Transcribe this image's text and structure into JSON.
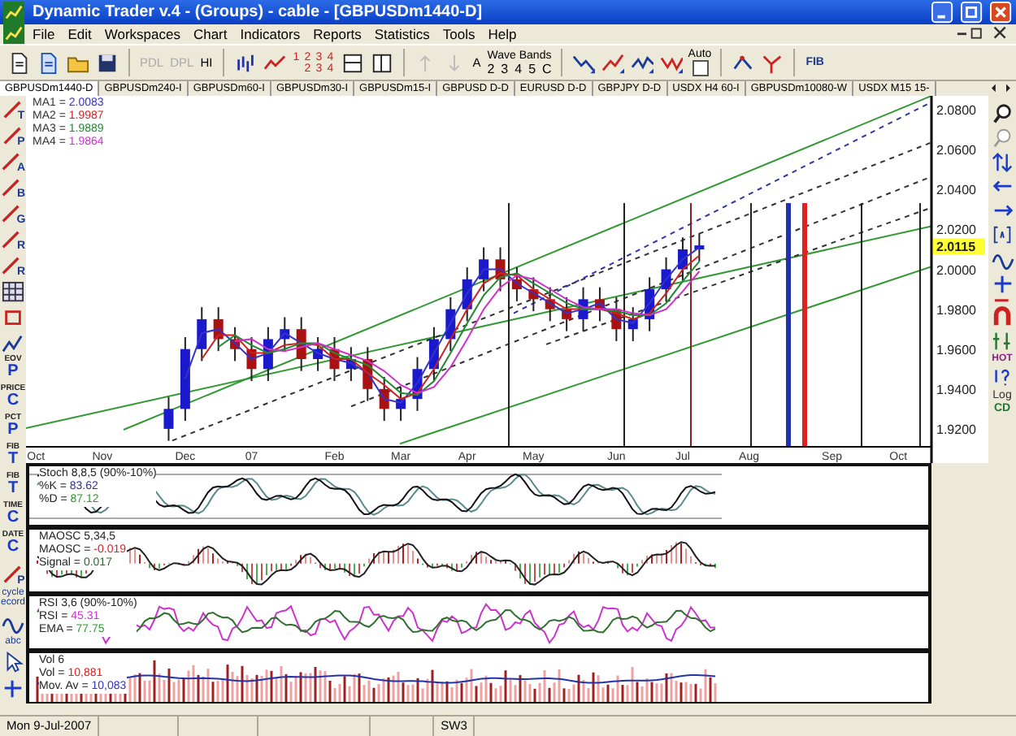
{
  "window": {
    "title": "Dynamic Trader v.4 - (Groups) - cable - [GBPUSDm1440-D]"
  },
  "menu": [
    "File",
    "Edit",
    "Workspaces",
    "Chart",
    "Indicators",
    "Reports",
    "Statistics",
    "Tools",
    "Help"
  ],
  "toolbar": {
    "text_buttons": [
      {
        "label": "PDL",
        "disabled": true
      },
      {
        "label": "DPL",
        "disabled": true
      },
      {
        "label": "HI",
        "disabled": false
      }
    ],
    "bar_counts": [
      [
        "1",
        "2",
        "3",
        "4"
      ],
      [
        "2",
        "3",
        "4"
      ]
    ],
    "letter_button": "A",
    "wave_bands": {
      "title": "Wave Bands",
      "buttons": [
        "2",
        "3",
        "4",
        "5",
        "C"
      ]
    },
    "auto": {
      "label": "Auto",
      "checked": false
    },
    "fib_button": "FIB"
  },
  "tabs": [
    {
      "label": "GBPUSDm1440-D",
      "selected": true
    },
    {
      "label": "GBPUSDm240-I",
      "selected": false
    },
    {
      "label": "GBPUSDm60-I",
      "selected": false
    },
    {
      "label": "GBPUSDm30-I",
      "selected": false
    },
    {
      "label": "GBPUSDm15-I",
      "selected": false
    },
    {
      "label": "GBPUSD D-D",
      "selected": false
    },
    {
      "label": "EURUSD D-D",
      "selected": false
    },
    {
      "label": "GBPJPY D-D",
      "selected": false
    },
    {
      "label": "USDX  H4 60-I",
      "selected": false
    },
    {
      "label": "GBPUSDm10080-W",
      "selected": false
    },
    {
      "label": "USDX  M15 15-",
      "selected": false
    }
  ],
  "left_tools": [
    {
      "kind": "tool",
      "label": "T"
    },
    {
      "kind": "tool",
      "label": "P"
    },
    {
      "kind": "tool",
      "label": "A"
    },
    {
      "kind": "tool",
      "label": "B"
    },
    {
      "kind": "tool",
      "label": "G"
    },
    {
      "kind": "tool",
      "label": "R"
    },
    {
      "kind": "tool",
      "label": "R"
    },
    {
      "kind": "grid"
    },
    {
      "kind": "rect"
    },
    {
      "kind": "zigzag"
    },
    {
      "kind": "stack",
      "top": "EOV",
      "label": "P"
    },
    {
      "kind": "stack",
      "top": "PRICE",
      "label": "C"
    },
    {
      "kind": "stack",
      "top": "PCT",
      "label": "P"
    },
    {
      "kind": "stack",
      "top": "FIB",
      "label": "T"
    },
    {
      "kind": "stack",
      "top": "FIB",
      "label": "T"
    },
    {
      "kind": "stack",
      "top": "TIME",
      "label": "C"
    },
    {
      "kind": "stack",
      "top": "DATE",
      "label": "C"
    },
    {
      "kind": "tool",
      "label": "P"
    },
    {
      "kind": "words",
      "label": "cycle ecord"
    },
    {
      "kind": "wave"
    },
    {
      "kind": "words",
      "label": "abc"
    },
    {
      "kind": "cursor"
    },
    {
      "kind": "plus"
    }
  ],
  "right_tools": [
    {
      "kind": "zoomin"
    },
    {
      "kind": "zoomout"
    },
    {
      "kind": "updown"
    },
    {
      "kind": "left"
    },
    {
      "kind": "right"
    },
    {
      "kind": "bracket"
    },
    {
      "kind": "wave"
    },
    {
      "kind": "plus"
    },
    {
      "kind": "minus"
    },
    {
      "kind": "magnet"
    },
    {
      "kind": "bars"
    },
    {
      "kind": "words",
      "label": "HOT"
    },
    {
      "kind": "help"
    },
    {
      "kind": "words",
      "label": "Log"
    },
    {
      "kind": "words",
      "label": "CD"
    }
  ],
  "price_panel": {
    "moving_averages": [
      {
        "label": "MA1 =",
        "value": "2.0083"
      },
      {
        "label": "MA2 =",
        "value": "1.9987"
      },
      {
        "label": "MA3 =",
        "value": "1.9889"
      },
      {
        "label": "MA4 =",
        "value": "1.9864"
      }
    ],
    "current_price": "2.0115",
    "chart_data": {
      "type": "candlestick",
      "categories": [
        "Oct",
        null,
        null,
        null,
        "Nov",
        null,
        null,
        null,
        null,
        "Dec",
        null,
        null,
        null,
        "07",
        null,
        null,
        null,
        null,
        "Feb",
        null,
        null,
        null,
        "Mar",
        null,
        null,
        null,
        "Apr",
        null,
        null,
        null,
        "May",
        null,
        null,
        null,
        null,
        "Jun",
        null,
        null,
        null,
        "Jul",
        null,
        null,
        null,
        "Aug",
        null,
        null,
        null,
        null,
        "Sep",
        null,
        null,
        null,
        "Oct",
        null
      ],
      "ohlc": [
        null,
        null,
        null,
        null,
        null,
        null,
        null,
        null,
        [
          1.92,
          1.936,
          1.914,
          1.93
        ],
        [
          1.93,
          1.966,
          1.924,
          1.96
        ],
        [
          1.96,
          1.981,
          1.954,
          1.975
        ],
        [
          1.975,
          1.981,
          1.959,
          1.965
        ],
        [
          1.965,
          1.971,
          1.954,
          1.96
        ],
        [
          1.96,
          1.966,
          1.944,
          1.95
        ],
        [
          1.95,
          1.971,
          1.944,
          1.965
        ],
        [
          1.965,
          1.976,
          1.959,
          1.97
        ],
        [
          1.97,
          1.976,
          1.949,
          1.955
        ],
        [
          1.955,
          1.966,
          1.949,
          1.96
        ],
        [
          1.96,
          1.966,
          1.944,
          1.95
        ],
        [
          1.95,
          1.961,
          1.944,
          1.955
        ],
        [
          1.955,
          1.961,
          1.934,
          1.94
        ],
        [
          1.94,
          1.946,
          1.924,
          1.93
        ],
        [
          1.93,
          1.941,
          1.924,
          1.935
        ],
        [
          1.935,
          1.956,
          1.929,
          1.95
        ],
        [
          1.95,
          1.971,
          1.944,
          1.965
        ],
        [
          1.965,
          1.986,
          1.959,
          1.98
        ],
        [
          1.98,
          2.001,
          1.974,
          1.995
        ],
        [
          1.995,
          2.011,
          1.989,
          2.005
        ],
        [
          2.005,
          2.011,
          1.989,
          1.995
        ],
        [
          1.995,
          2.001,
          1.984,
          1.99
        ],
        [
          1.99,
          1.996,
          1.979,
          1.985
        ],
        [
          1.985,
          1.991,
          1.974,
          1.98
        ],
        [
          1.98,
          1.986,
          1.969,
          1.975
        ],
        [
          1.975,
          1.991,
          1.969,
          1.985
        ],
        [
          1.985,
          1.991,
          1.974,
          1.98
        ],
        [
          1.98,
          1.986,
          1.964,
          1.97
        ],
        [
          1.97,
          1.981,
          1.964,
          1.975
        ],
        [
          1.975,
          1.996,
          1.969,
          1.99
        ],
        [
          1.99,
          2.006,
          1.984,
          2.0
        ],
        [
          2.0,
          2.016,
          1.994,
          2.01
        ],
        [
          2.01,
          2.018,
          2.004,
          2.012
        ],
        null,
        null,
        null,
        null,
        null,
        null,
        null,
        null,
        null,
        null,
        null,
        null,
        null
      ],
      "series": [
        {
          "type": "line",
          "color": "#3333cc",
          "values": [
            null,
            null,
            null,
            null,
            null,
            null,
            null,
            null,
            null,
            1.945,
            1.968,
            1.97,
            1.963,
            1.955,
            1.958,
            1.968,
            1.963,
            1.958,
            1.955,
            1.953,
            1.948,
            1.935,
            1.933,
            1.943,
            1.958,
            1.973,
            1.988,
            2.0,
            2.0,
            1.993,
            1.988,
            1.983,
            1.978,
            1.98,
            1.983,
            1.975,
            1.973,
            1.983,
            1.995,
            2.005,
            2.011,
            null,
            null,
            null,
            null,
            null,
            null,
            null,
            null,
            null,
            null,
            null,
            null,
            null
          ]
        },
        {
          "type": "line",
          "color": "#cc2222",
          "values": [
            null,
            null,
            null,
            null,
            null,
            null,
            null,
            null,
            null,
            null,
            1.955,
            1.967,
            1.967,
            1.958,
            1.958,
            1.962,
            1.963,
            1.962,
            1.955,
            1.955,
            1.948,
            1.942,
            1.935,
            1.938,
            1.95,
            1.965,
            1.98,
            1.993,
            1.998,
            1.997,
            1.99,
            1.985,
            1.98,
            1.98,
            1.98,
            1.978,
            1.975,
            1.978,
            1.988,
            2.0,
            2.007,
            null,
            null,
            null,
            null,
            null,
            null,
            null,
            null,
            null,
            null,
            null,
            null,
            null
          ]
        },
        {
          "type": "line",
          "color": "#228833",
          "values": [
            null,
            null,
            null,
            null,
            null,
            null,
            null,
            null,
            null,
            null,
            null,
            1.961,
            1.967,
            1.962,
            1.958,
            1.96,
            1.963,
            1.963,
            1.958,
            1.955,
            1.952,
            1.945,
            1.938,
            1.937,
            1.944,
            1.958,
            1.973,
            1.987,
            1.996,
            1.998,
            1.993,
            1.988,
            1.983,
            1.98,
            1.98,
            1.979,
            1.977,
            1.977,
            1.983,
            1.994,
            2.004,
            null,
            null,
            null,
            null,
            null,
            null,
            null,
            null,
            null,
            null,
            null,
            null,
            null
          ]
        },
        {
          "type": "line",
          "color": "#cc33cc",
          "values": [
            null,
            null,
            null,
            null,
            null,
            null,
            null,
            null,
            null,
            null,
            null,
            null,
            1.964,
            1.965,
            1.96,
            1.959,
            1.961,
            1.963,
            1.96,
            1.957,
            1.954,
            1.949,
            1.942,
            1.938,
            1.941,
            1.951,
            1.965,
            1.98,
            1.991,
            1.997,
            1.995,
            1.99,
            1.985,
            1.981,
            1.98,
            1.98,
            1.978,
            1.977,
            1.98,
            1.989,
            1.999,
            null,
            null,
            null,
            null,
            null,
            null,
            null,
            null,
            null,
            null,
            null,
            null,
            null
          ]
        }
      ],
      "ylim": [
        1.911,
        2.087
      ],
      "yticks": [
        {
          "value": 2.08,
          "label": "2.0800"
        },
        {
          "value": 2.06,
          "label": "2.0600"
        },
        {
          "value": 2.04,
          "label": "2.0400"
        },
        {
          "value": 2.02,
          "label": "2.0200"
        },
        {
          "value": 2.0,
          "label": "2.0000"
        },
        {
          "value": 1.98,
          "label": "1.9800"
        },
        {
          "value": 1.96,
          "label": "1.9600"
        },
        {
          "value": 1.94,
          "label": "1.9400"
        },
        {
          "value": 1.92,
          "label": "1.9200"
        }
      ]
    }
  },
  "indicators": [
    {
      "kind": "stochastic",
      "title": "Stoch 8,8,5 (90%-10%)",
      "readouts": [
        {
          "label": "%K =",
          "value": "83.62",
          "color": "#333399"
        },
        {
          "label": "%D =",
          "value": "87.12",
          "color": "#339933"
        }
      ]
    },
    {
      "kind": "oscillator",
      "title": "MAOSC 5,34,5",
      "readouts": [
        {
          "label": "MAOSC =",
          "value": "-0.019",
          "color": "#dd2222"
        },
        {
          "label": "Signal =",
          "value": "0.017",
          "color": "#336633"
        }
      ]
    },
    {
      "kind": "rsi",
      "title": "RSI 3,6 (90%-10%)",
      "readouts": [
        {
          "label": "RSI =",
          "value": "45.31",
          "color": "#cc33cc"
        },
        {
          "label": "EMA =",
          "value": "77.75",
          "color": "#339933"
        }
      ]
    },
    {
      "kind": "volume",
      "title": "Vol 6",
      "readouts": [
        {
          "label": "Vol =",
          "value": "10,881",
          "color": "#dd2222"
        },
        {
          "label": "Mov. Av =",
          "value": "10,083",
          "color": "#3333cc"
        }
      ]
    }
  ],
  "status_bar": {
    "date": "Mon 9-Jul-2007",
    "workspace": "SW3"
  }
}
